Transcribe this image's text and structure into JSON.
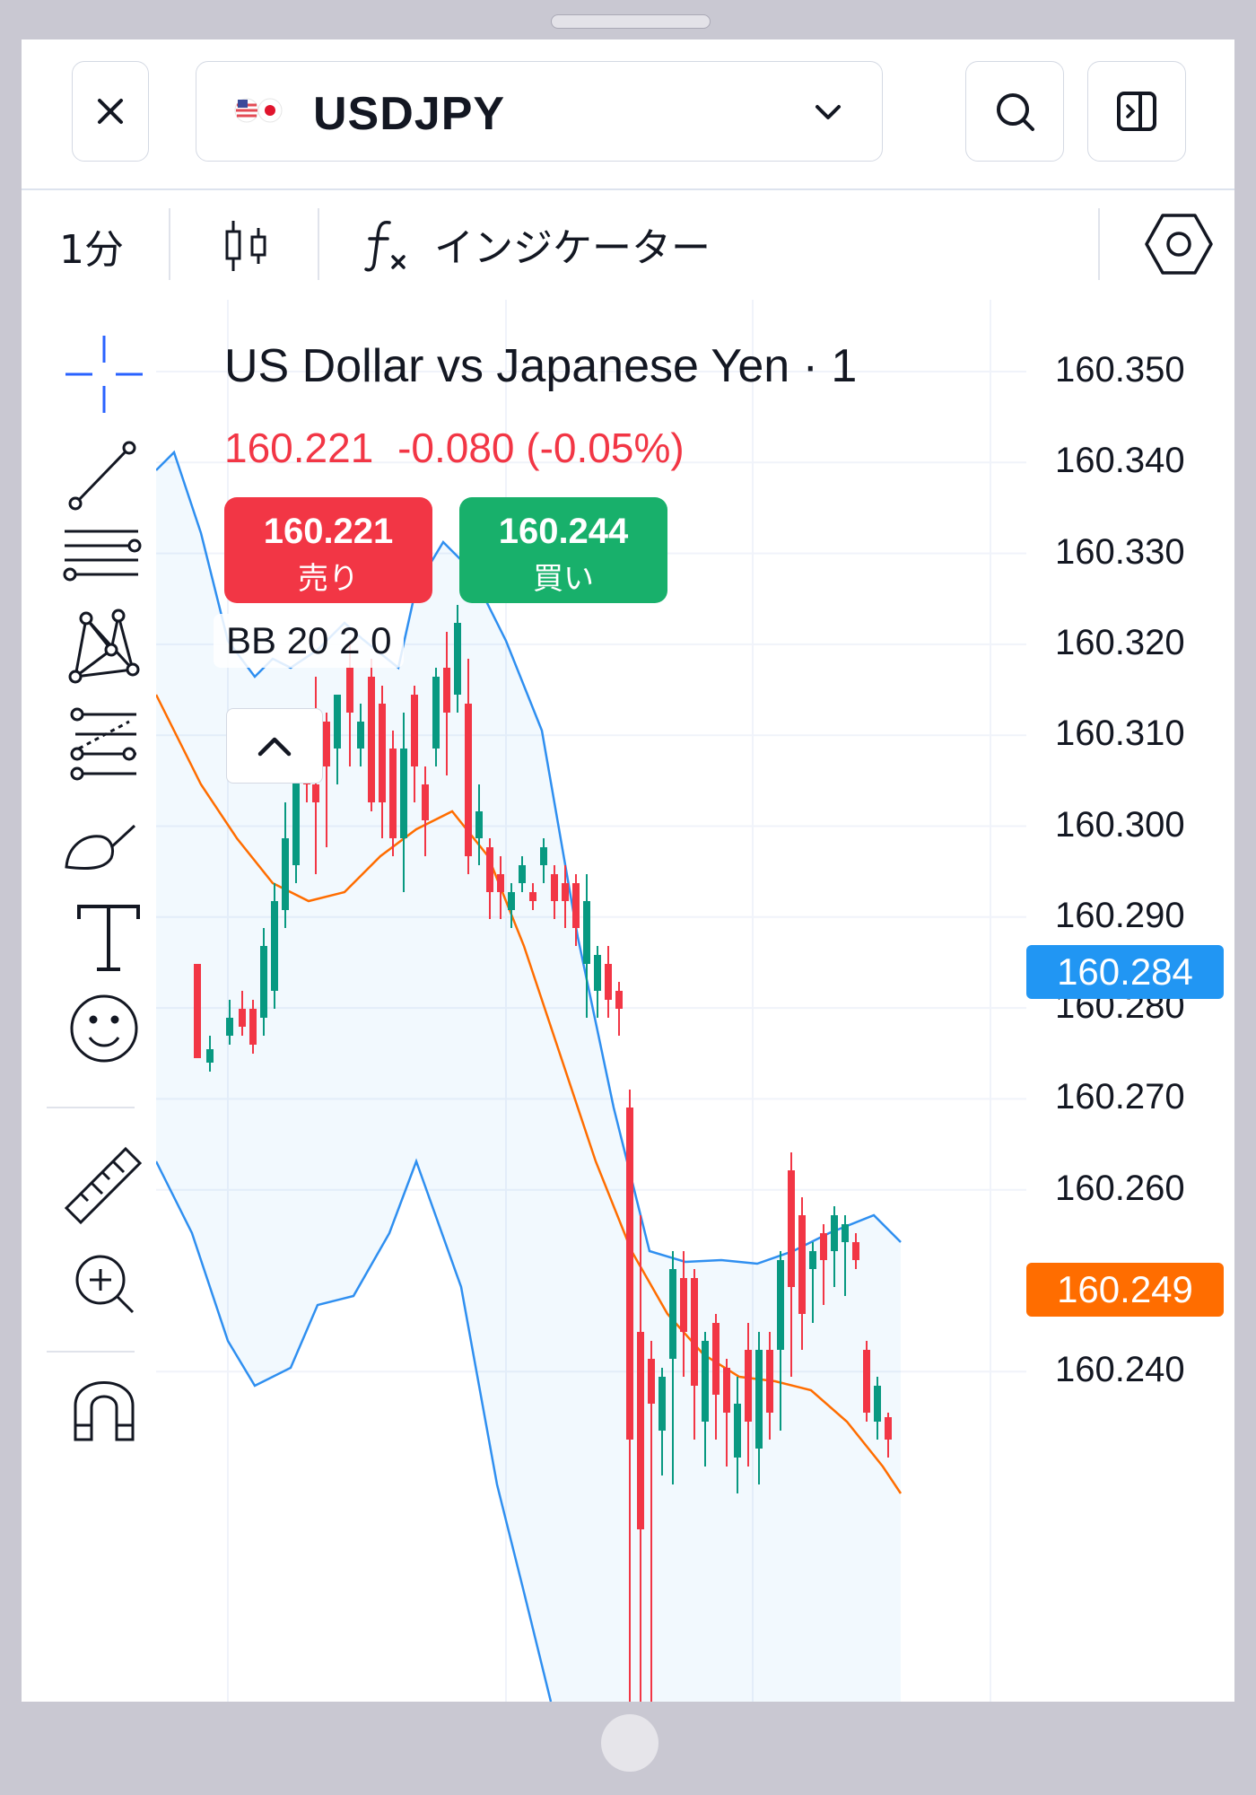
{
  "header": {
    "symbol": "USDJPY",
    "icons": {
      "close": "close-icon",
      "dropdown": "chevron-down-icon",
      "search": "search-icon",
      "panel": "panel-toggle-icon",
      "flag": "us-jp-flag-icon"
    }
  },
  "toolbar": {
    "interval": "1分",
    "chart_type_icon": "candlestick-icon",
    "indicator_icon": "fx-icon",
    "indicators_label": "インジケーター",
    "settings_icon": "settings-hex-icon"
  },
  "drawing_tools": [
    "crosshair-icon",
    "trend-line-icon",
    "horizontal-lines-icon",
    "pattern-icon",
    "fib-retracement-icon",
    "brush-icon",
    "text-icon",
    "emoji-icon",
    "ruler-icon",
    "zoom-in-icon",
    "magnet-icon"
  ],
  "legend": {
    "title": "US Dollar vs Japanese Yen · 1",
    "price": "160.221",
    "change": "-0.080 (-0.05%)",
    "indicator": "BB 20 2 0"
  },
  "trade": {
    "sell_price": "160.221",
    "sell_label": "売り",
    "buy_price": "160.244",
    "buy_label": "買い"
  },
  "price_axis": {
    "labels": [
      "160.350",
      "160.340",
      "160.330",
      "160.320",
      "160.310",
      "160.300",
      "160.290",
      "160.280",
      "160.270",
      "160.260",
      "160.240"
    ],
    "last_price_tag": "160.284",
    "basis_tag": "160.249"
  },
  "colors": {
    "sell": "#f23645",
    "buy": "#18b06b",
    "up_candle": "#089981",
    "down_candle": "#f23645",
    "bb_band": "#2f8ff0",
    "bb_basis": "#ff6d00",
    "tag_blue": "#2196f3",
    "tag_orange": "#ff6d00"
  }
}
